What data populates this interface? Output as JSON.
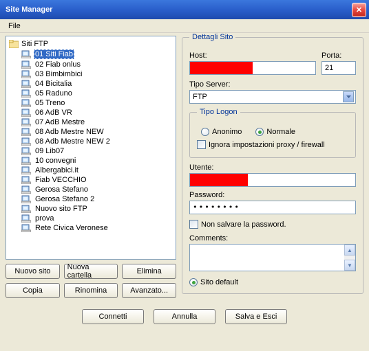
{
  "window": {
    "title": "Site Manager",
    "close_glyph": "✕"
  },
  "menu": {
    "file": "File"
  },
  "tree": {
    "root": "Siti FTP",
    "items": [
      {
        "label": "01 Siti Fiab",
        "selected": true
      },
      {
        "label": "02 Fiab onlus"
      },
      {
        "label": "03 Bimbimbici"
      },
      {
        "label": "04 Bicitalia"
      },
      {
        "label": "05 Raduno"
      },
      {
        "label": "05 Treno"
      },
      {
        "label": "06 AdB VR"
      },
      {
        "label": "07 AdB Mestre"
      },
      {
        "label": "08 Adb Mestre NEW"
      },
      {
        "label": "08 Adb Mestre NEW 2"
      },
      {
        "label": "09 Lib07"
      },
      {
        "label": "10 convegni"
      },
      {
        "label": "Albergabici.it"
      },
      {
        "label": "Fiab VECCHIO"
      },
      {
        "label": "Gerosa Stefano"
      },
      {
        "label": "Gerosa Stefano 2"
      },
      {
        "label": "Nuovo sito FTP"
      },
      {
        "label": "prova"
      },
      {
        "label": "Rete Civica Veronese"
      }
    ]
  },
  "buttons": {
    "new_site": "Nuovo sito",
    "new_folder": "Nuova cartella",
    "delete": "Elimina",
    "copy": "Copia",
    "rename": "Rinomina",
    "advanced": "Avanzato..."
  },
  "details": {
    "section_title": "Dettagli Sito",
    "host_label": "Host:",
    "host_value": "",
    "port_label": "Porta:",
    "port_value": "21",
    "server_type_label": "Tipo Server:",
    "server_type_value": "FTP",
    "logon": {
      "title": "Tipo Logon",
      "anon": "Anonimo",
      "normal": "Normale",
      "selected": "normal",
      "ignore_proxy": "Ignora impostazioni proxy / firewall"
    },
    "user_label": "Utente:",
    "user_value": "",
    "password_label": "Password:",
    "password_value": "••••••••",
    "no_save_password": "Non salvare la password.",
    "comments_label": "Comments:",
    "comments_value": "",
    "default_site": "Sito default"
  },
  "bottom": {
    "connect": "Connetti",
    "cancel": "Annulla",
    "save_exit": "Salva e Esci"
  }
}
